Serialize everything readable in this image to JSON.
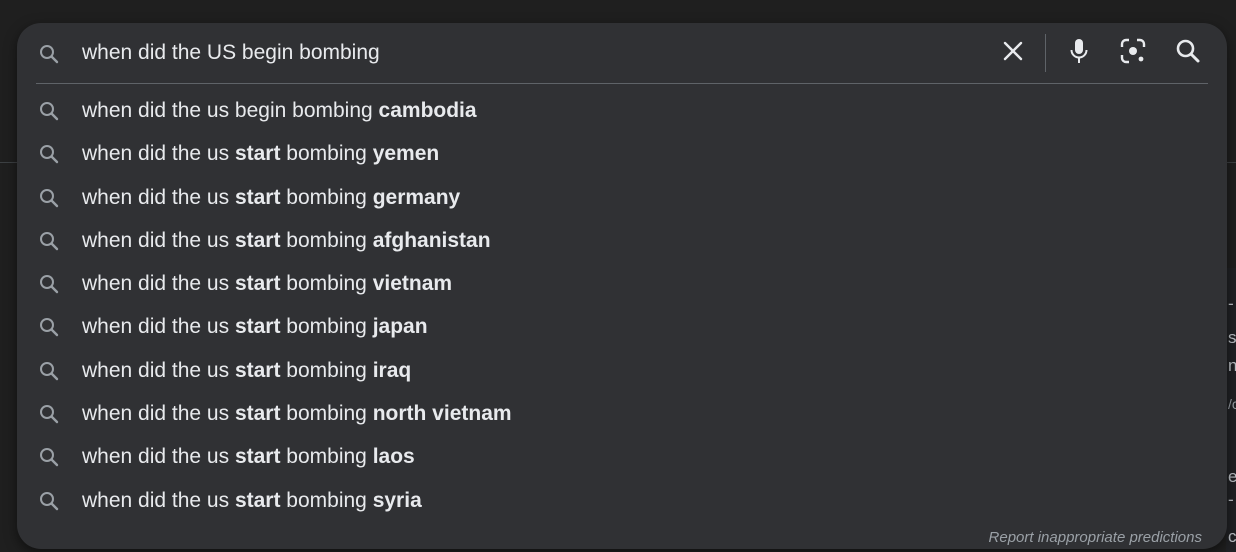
{
  "search": {
    "query": "when did the US begin bombing"
  },
  "icons": {
    "search": "search-icon",
    "clear": "close-icon",
    "voice": "microphone-icon",
    "lens": "camera-lens-icon",
    "submit": "search-icon"
  },
  "suggestions": [
    {
      "prefix": "when did the us begin bombing ",
      "mid": "",
      "mid2": "",
      "suffix": "cambodia"
    },
    {
      "prefix": "when did the us ",
      "mid": "start",
      "mid2": " bombing ",
      "suffix": "yemen"
    },
    {
      "prefix": "when did the us ",
      "mid": "start",
      "mid2": " bombing ",
      "suffix": "germany"
    },
    {
      "prefix": "when did the us ",
      "mid": "start",
      "mid2": " bombing ",
      "suffix": "afghanistan"
    },
    {
      "prefix": "when did the us ",
      "mid": "start",
      "mid2": " bombing ",
      "suffix": "vietnam"
    },
    {
      "prefix": "when did the us ",
      "mid": "start",
      "mid2": " bombing ",
      "suffix": "japan"
    },
    {
      "prefix": "when did the us ",
      "mid": "start",
      "mid2": " bombing ",
      "suffix": "iraq"
    },
    {
      "prefix": "when did the us ",
      "mid": "start",
      "mid2": " bombing ",
      "suffix": "north vietnam"
    },
    {
      "prefix": "when did the us ",
      "mid": "start",
      "mid2": " bombing ",
      "suffix": "laos"
    },
    {
      "prefix": "when did the us ",
      "mid": "start",
      "mid2": " bombing ",
      "suffix": "syria"
    }
  ],
  "report_link": "Report inappropriate predictions",
  "background_fragments": [
    "-",
    "s",
    "n",
    "/c",
    "e",
    "-",
    "co"
  ],
  "colors": {
    "panel": "#303134",
    "text": "#e8eaed",
    "muted": "#9aa0a6",
    "page": "#1f1f1f"
  }
}
